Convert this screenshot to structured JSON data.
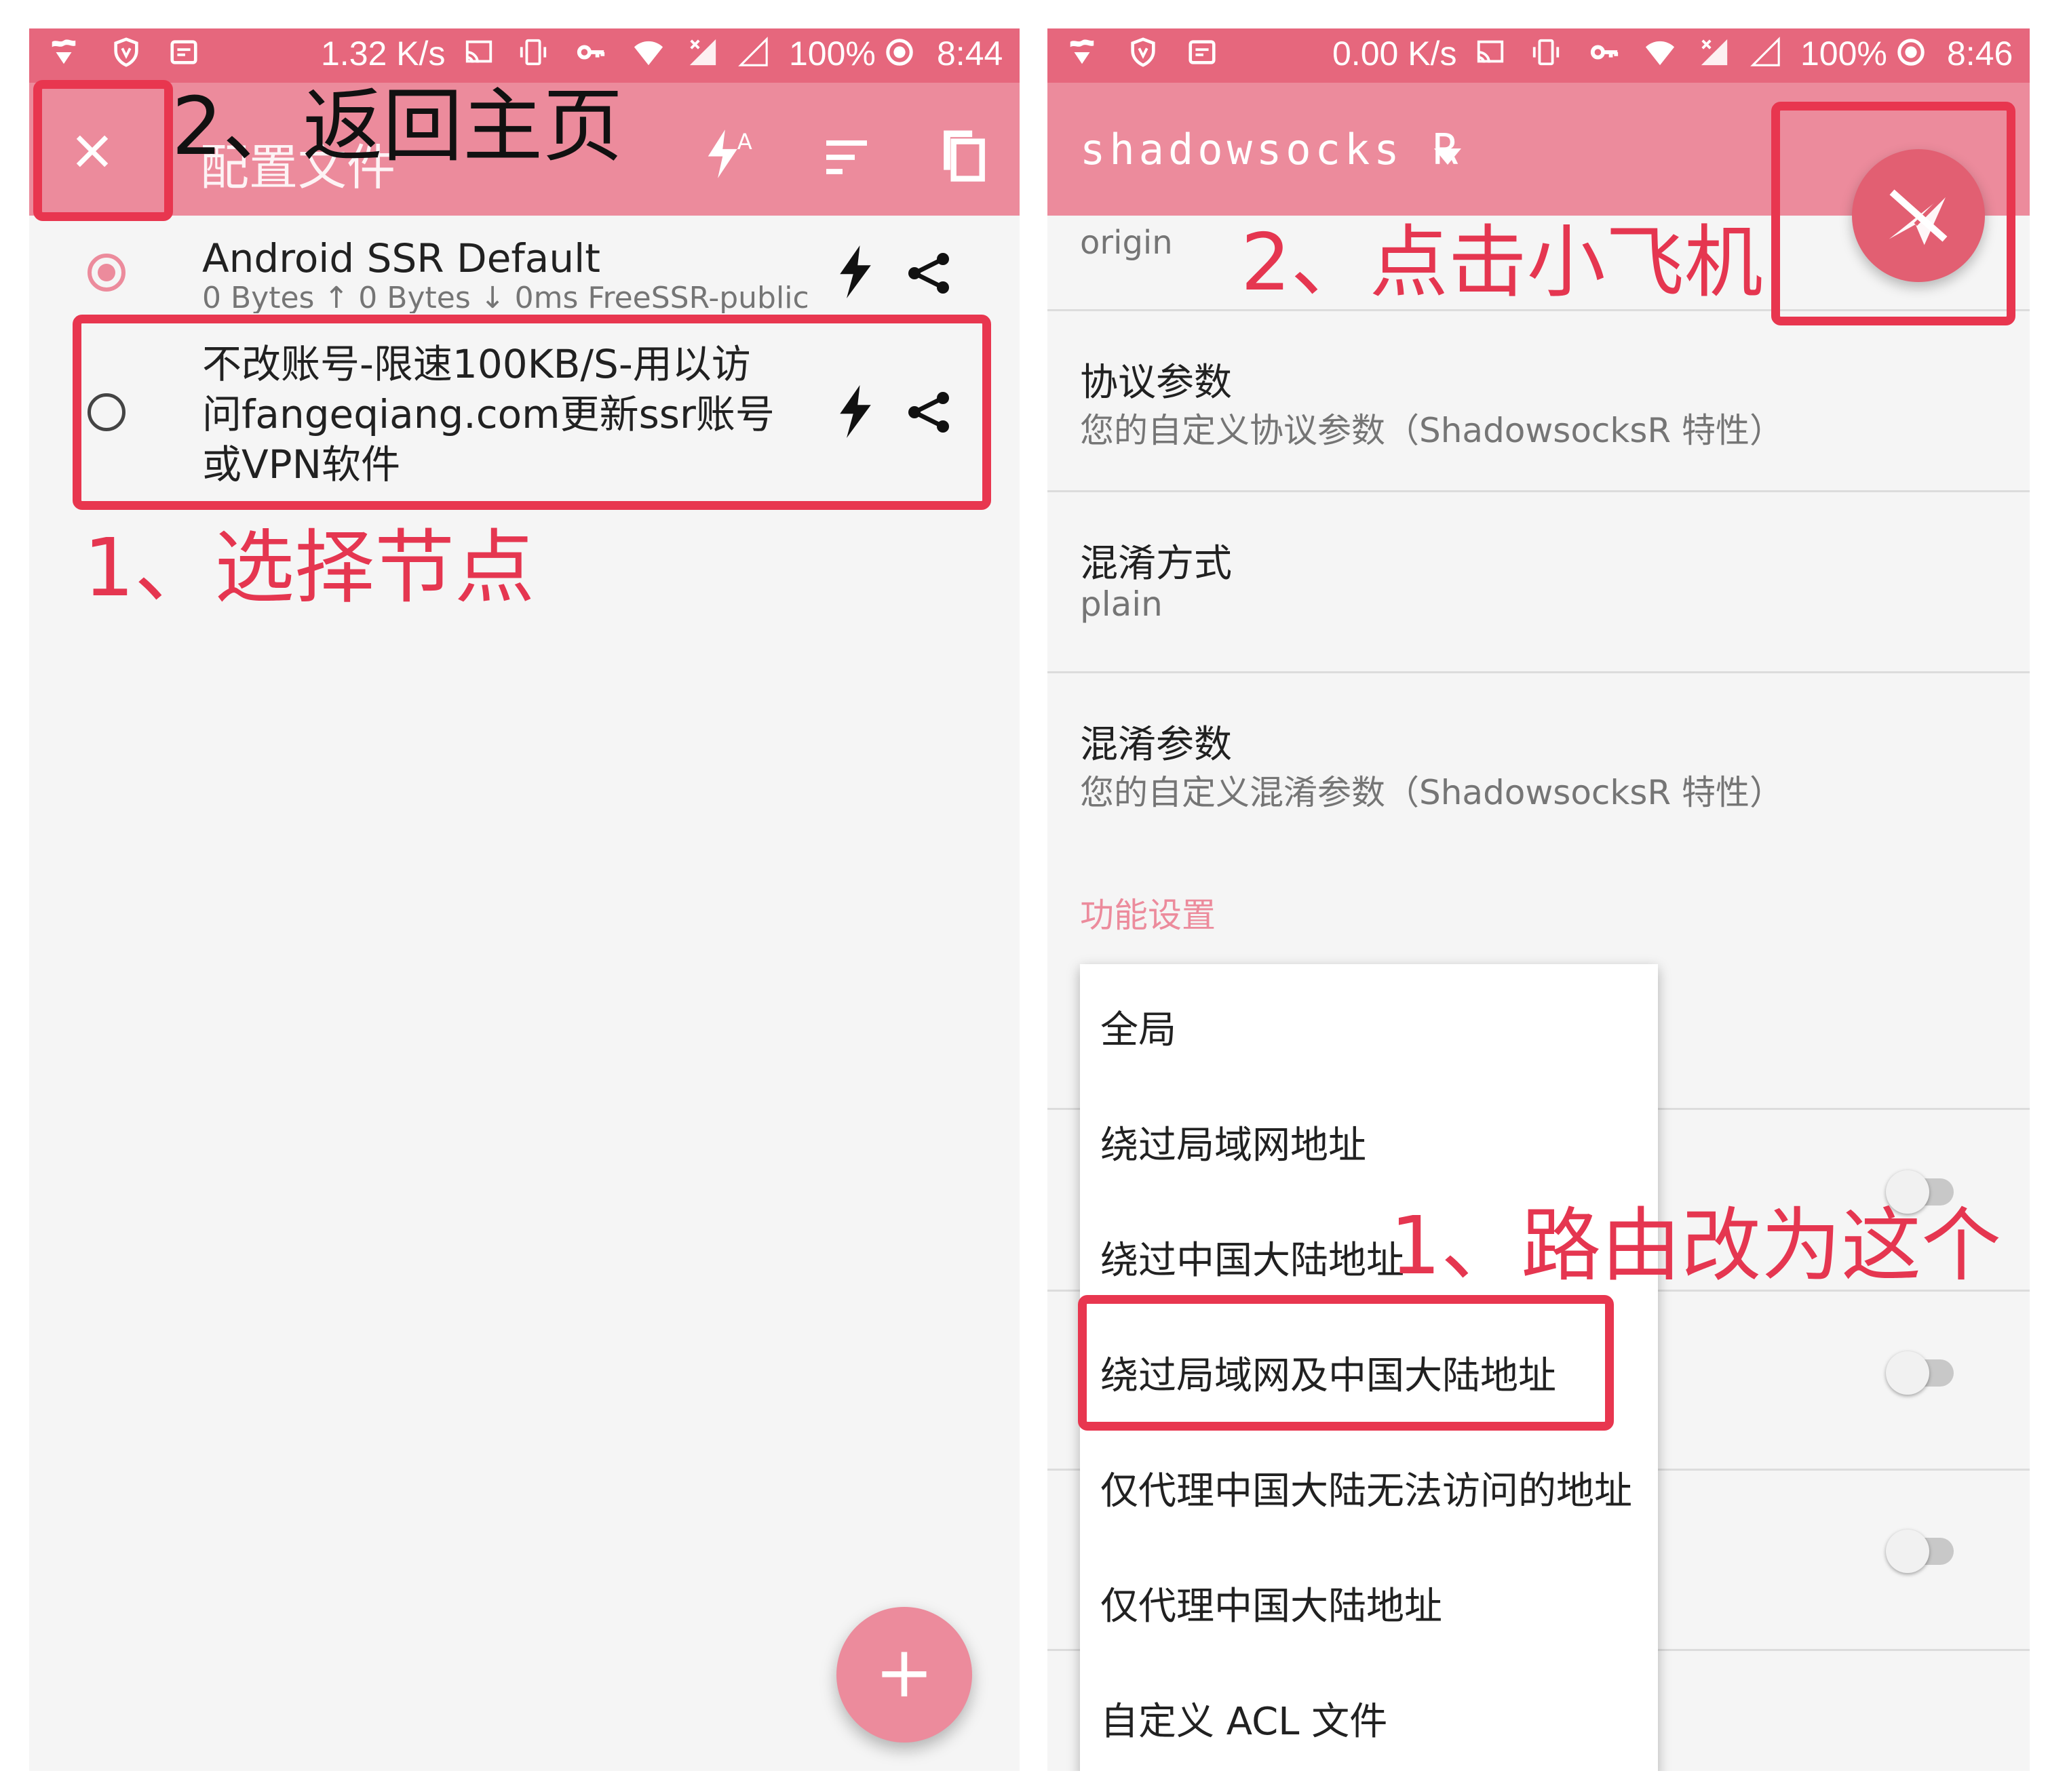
{
  "left": {
    "status": {
      "speed": "1.32 K/s",
      "battery": "100%",
      "time": "8:44"
    },
    "toolbar": {
      "title": "配置文件"
    },
    "profiles": [
      {
        "name": "Android SSR Default",
        "stats": "0 Bytes ↑ 0 Bytes ↓ 0ms FreeSSR-public",
        "selected": true
      },
      {
        "name_lines": [
          "不改账号-限速100KB/S-用以访",
          "问fangeqiang.com更新ssr账号",
          "或VPN软件"
        ],
        "selected": false
      }
    ],
    "annotations": {
      "back_home": "2、返回主页",
      "select_node": "1、选择节点"
    },
    "fab_label": "+"
  },
  "right": {
    "status": {
      "speed": "0.00 K/s",
      "battery": "100%",
      "time": "8:46"
    },
    "toolbar": {
      "title": "shadowsocks R"
    },
    "prefs": {
      "protocol_value": "origin",
      "protocol_param_title": "协议参数",
      "protocol_param_summary": "您的自定义协议参数（ShadowsocksR 特性）",
      "obfs_title": "混淆方式",
      "obfs_value": "plain",
      "obfs_param_title": "混淆参数",
      "obfs_param_summary": "您的自定义混淆参数（ShadowsocksR 特性）",
      "section_features": "功能设置"
    },
    "route_options": [
      "全局",
      "绕过局域网地址",
      "绕过中国大陆地址",
      "绕过局域网及中国大陆地址",
      "仅代理中国大陆无法访问的地址",
      "仅代理中国大陆地址",
      "自定义 ACL 文件"
    ],
    "selected_route": "绕过局域网及中国大陆地址",
    "annotations": {
      "click_plane": "2、点击小飞机",
      "route_change": "1、路由改为这个"
    }
  },
  "colors": {
    "statusbar": "#e6677d",
    "toolbar": "#ec8b9c",
    "annotation_red": "#e53650",
    "fab_plane": "#e25f72"
  },
  "icons": [
    "shield-icon",
    "vpn-icon",
    "mail-icon",
    "cast-icon",
    "vibrate-icon",
    "key-icon",
    "wifi-icon",
    "signal-icon",
    "battery-icon",
    "close-icon",
    "auto-test-icon",
    "sort-icon",
    "copy-icon",
    "lightning-icon",
    "share-icon",
    "dropdown-arrow-icon",
    "paper-plane-icon",
    "plus-icon"
  ]
}
